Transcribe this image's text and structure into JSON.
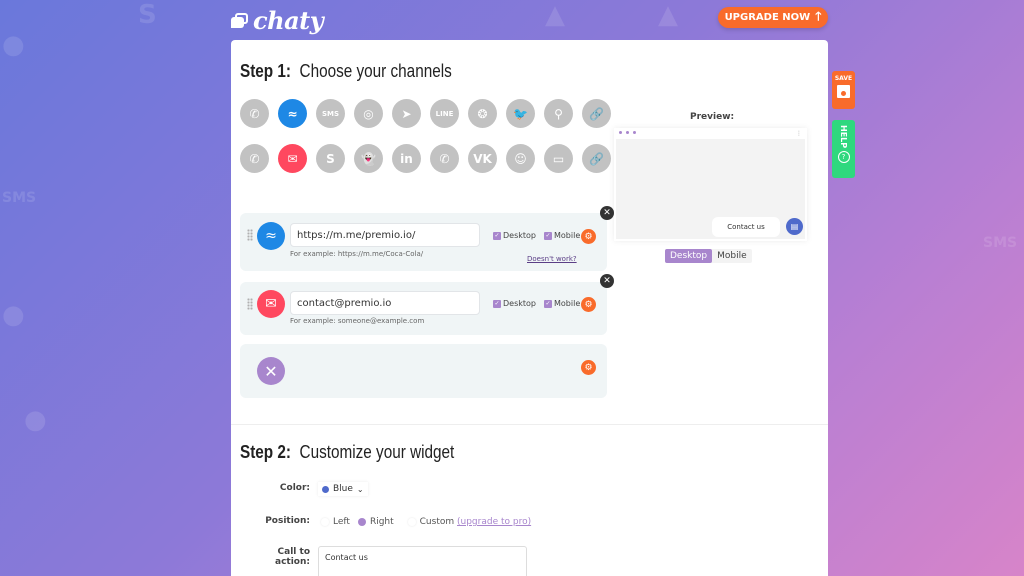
{
  "brand": {
    "name": "chaty"
  },
  "header": {
    "upgrade_label": "UPGRADE NOW",
    "upgrade_icon": "arrow-up-icon"
  },
  "side_buttons": {
    "save_label": "SAVE",
    "help_label": "HELP",
    "help_icon": "?"
  },
  "step1": {
    "number": "Step 1:",
    "title": "Choose your channels",
    "channels_row1": [
      {
        "name": "whatsapp",
        "glyph": "✆",
        "selected": false
      },
      {
        "name": "facebook-messenger",
        "glyph": "≈",
        "selected": true
      },
      {
        "name": "sms",
        "glyph": "SMS",
        "selected": false
      },
      {
        "name": "instagram",
        "glyph": "◎",
        "selected": false
      },
      {
        "name": "telegram",
        "glyph": "➤",
        "selected": false
      },
      {
        "name": "line",
        "glyph": "LINE",
        "selected": false
      },
      {
        "name": "wechat",
        "glyph": "❂",
        "selected": false
      },
      {
        "name": "twitter",
        "glyph": "🐦",
        "selected": false
      },
      {
        "name": "google-maps",
        "glyph": "⚲",
        "selected": false
      },
      {
        "name": "custom-link",
        "glyph": "🔗",
        "selected": false
      }
    ],
    "channels_row2": [
      {
        "name": "phone",
        "glyph": "✆",
        "selected": false
      },
      {
        "name": "email",
        "glyph": "✉",
        "selected": true
      },
      {
        "name": "skype",
        "glyph": "S",
        "selected": false
      },
      {
        "name": "snapchat",
        "glyph": "👻",
        "selected": false
      },
      {
        "name": "linkedin",
        "glyph": "in",
        "selected": false
      },
      {
        "name": "viber",
        "glyph": "✆",
        "selected": false
      },
      {
        "name": "vkontakte",
        "glyph": "VK",
        "selected": false
      },
      {
        "name": "waze",
        "glyph": "☺",
        "selected": false
      },
      {
        "name": "poptin",
        "glyph": "▭",
        "selected": false
      },
      {
        "name": "custom-link-2",
        "glyph": "🔗",
        "selected": false
      }
    ],
    "configured": [
      {
        "channel": "Facebook Messenger",
        "value": "https://m.me/premio.io/",
        "hint": "For example: https://m.me/Coca-Cola/",
        "desktop_label": "Desktop",
        "desktop_checked": true,
        "mobile_label": "Mobile",
        "mobile_checked": true,
        "help_link": "Doesn't work?"
      },
      {
        "channel": "Email",
        "value": "contact@premio.io",
        "hint": "For example: someone@example.com",
        "desktop_label": "Desktop",
        "desktop_checked": true,
        "mobile_label": "Mobile",
        "mobile_checked": true
      }
    ],
    "close_trigger": {
      "channel": "close"
    }
  },
  "preview": {
    "label": "Preview:",
    "cta_text": "Contact us",
    "view_desktop": "Desktop",
    "view_mobile": "Mobile",
    "active_view": "Desktop"
  },
  "step2": {
    "number": "Step 2:",
    "title": "Customize your widget",
    "color_label": "Color:",
    "color_value": "Blue",
    "color_hex": "#4f6acb",
    "position_label": "Position:",
    "position_options": [
      "Left",
      "Right",
      "Custom"
    ],
    "position_selected": "Right",
    "upgrade_link": "(upgrade to pro)",
    "cta_label": "Call to action:",
    "cta_value": "Contact us"
  },
  "colors": {
    "accent_orange": "#f96b2b",
    "accent_purple": "#a886cd",
    "messenger_blue": "#1e88e5",
    "email_red": "#ff485f",
    "help_green": "#2fd87e"
  }
}
